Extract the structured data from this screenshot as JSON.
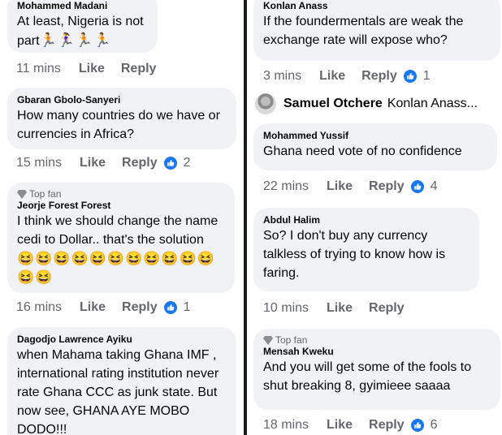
{
  "left": {
    "c1": {
      "name": "Mohammed Madani",
      "text": "At least, Nigeria is not part",
      "emoji": "🏃🏃‍♀️🏃🏃",
      "time": "11 mins",
      "like": "Like",
      "reply": "Reply"
    },
    "c2": {
      "name": "Gbaran Gbolo-Sanyeri",
      "text": "How many countries do we have or currencies in Africa?",
      "time": "15 mins",
      "like": "Like",
      "reply": "Reply",
      "count": "2"
    },
    "c3": {
      "badge": "Top fan",
      "name": "Jeorje Forest  Forest",
      "text": "I think we should change the name cedi to Dollar.. that's the solution",
      "emoji1": "😆😆😆😆😆😆😆😆😆😆😆",
      "emoji2": "😆😆",
      "time": "16 mins",
      "like": "Like",
      "reply": "Reply",
      "count": "1"
    },
    "c4": {
      "name": "Dagodjo Lawrence Ayiku",
      "text": "when Mahama taking Ghana IMF , international rating institution never rate Ghana CCC as junk state. But now see, GHANA AYE MOBO DODO!!!"
    }
  },
  "right": {
    "c1": {
      "name": "Konlan Anass",
      "text": "If the foundermentals are weak the exchange rate will expose who?",
      "time": "3 mins",
      "like": "Like",
      "reply": "Reply",
      "count": "1"
    },
    "replyrow": {
      "name": "Samuel Otchere",
      "preview": "Konlan Anass..."
    },
    "c2": {
      "name": "Mohammed Yussif",
      "text": "Ghana need vote of no confidence",
      "time": "22 mins",
      "like": "Like",
      "reply": "Reply",
      "count": "4"
    },
    "c3": {
      "name": "Abdul Halim",
      "text": "So? I don't buy any currency talkless of trying to know how is faring.",
      "time": "10 mins",
      "like": "Like",
      "reply": "Reply"
    },
    "c4": {
      "badge": "Top fan",
      "name": "Mensah Kweku",
      "text": "And you will get some of the fools to shut breaking 8, gyimieee saaaa",
      "time": "18 mins",
      "like": "Like",
      "reply": "Reply",
      "count": "6"
    }
  },
  "colors": {
    "bubble": "#f0f2f5",
    "meta": "#65676b",
    "text": "#050505",
    "like_blue": "#1877f2"
  }
}
